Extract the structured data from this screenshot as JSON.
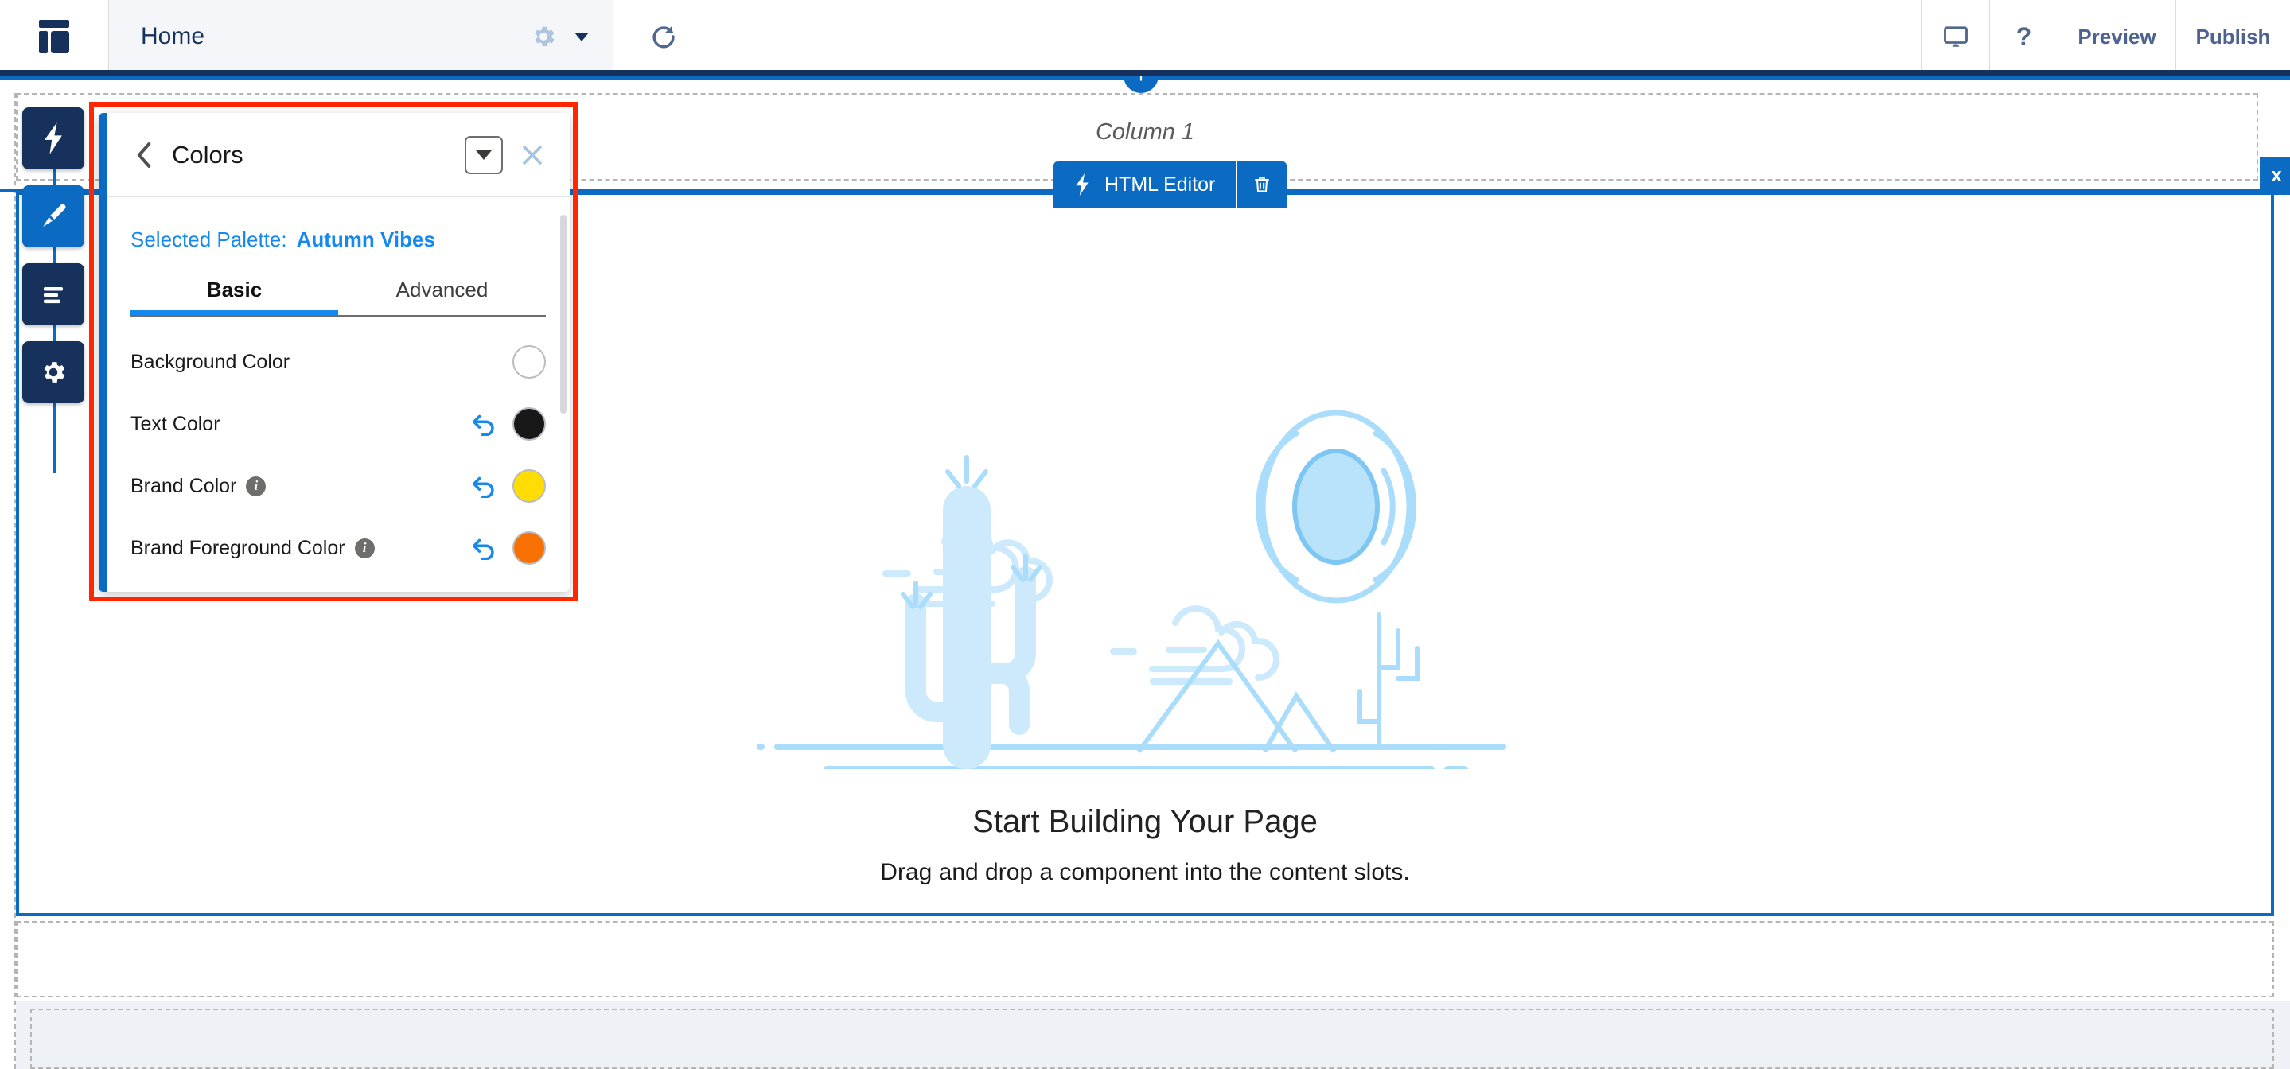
{
  "header": {
    "logo_icon": "page-layout-icon",
    "page_title": "Home",
    "gear_icon": "gear-icon",
    "caret_icon": "chevron-down-icon",
    "refresh_icon": "refresh-icon",
    "device_preview_icon": "desktop-monitor-icon",
    "help_label": "?",
    "preview_label": "Preview",
    "publish_label": "Publish"
  },
  "left_rail": {
    "items": [
      {
        "name": "components",
        "icon": "lightning-bolt-icon",
        "active": false
      },
      {
        "name": "themes",
        "icon": "paintbrush-icon",
        "active": true
      },
      {
        "name": "page-structure",
        "icon": "lines-list-icon",
        "active": false
      },
      {
        "name": "settings",
        "icon": "gear-icon",
        "active": false
      }
    ]
  },
  "panel": {
    "back_icon": "chevron-left-icon",
    "title": "Colors",
    "dropdown_icon": "chevron-down-icon",
    "close_icon": "close-icon",
    "selected_palette_label": "Selected Palette:",
    "selected_palette_value": "Autumn Vibes",
    "tabs": [
      {
        "label": "Basic",
        "active": true
      },
      {
        "label": "Advanced",
        "active": false
      }
    ],
    "color_rows": [
      {
        "label": "Background Color",
        "has_info": false,
        "has_revert": false,
        "revert_icon": "",
        "swatch_hex": "#ffffff"
      },
      {
        "label": "Text Color",
        "has_info": false,
        "has_revert": true,
        "revert_icon": "undo-arrow-icon",
        "swatch_hex": "#181818"
      },
      {
        "label": "Brand Color",
        "has_info": true,
        "info_icon": "info-icon",
        "has_revert": true,
        "revert_icon": "undo-arrow-icon",
        "swatch_hex": "#ffdd00"
      },
      {
        "label": "Brand Foreground Color",
        "has_info": true,
        "info_icon": "info-icon",
        "has_revert": true,
        "revert_icon": "undo-arrow-icon",
        "swatch_hex": "#f77000"
      }
    ]
  },
  "canvas": {
    "column_label": "Column 1",
    "add_above_label": "+",
    "add_below_label": "+",
    "close_component_label": "x",
    "toolbar": {
      "bolt_icon": "lightning-bolt-icon",
      "html_editor_label": "HTML Editor",
      "delete_icon": "trash-icon"
    },
    "empty_state": {
      "illustration": "desert-cactus-sun-illustration",
      "title": "Start Building Your Page",
      "subtitle": "Drag and drop a component into the content slots."
    }
  },
  "colors": {
    "navy": "#16325c",
    "brand_blue": "#0b6ac1",
    "link_blue": "#1589ee",
    "annotation_red": "#ff2600",
    "header_bg": "#f4f6f9",
    "illustration_blue": "#aaddfb"
  }
}
